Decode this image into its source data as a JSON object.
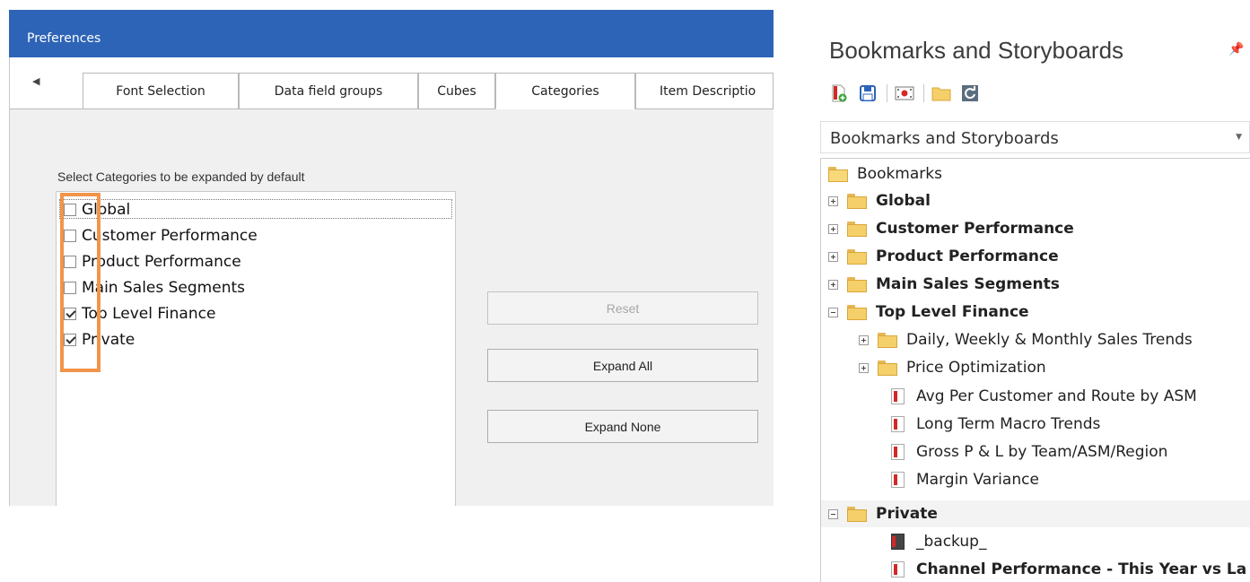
{
  "preferences": {
    "title": "Preferences",
    "tab_scroll_left": "◀",
    "tabs": [
      "Font Selection",
      "Data field groups",
      "Cubes",
      "Categories",
      "Item Descriptio"
    ],
    "active_tab": "Categories",
    "categories_label": "Select Categories to be expanded by default",
    "categories": [
      {
        "label": "Global",
        "checked": false
      },
      {
        "label": "Customer Performance",
        "checked": false
      },
      {
        "label": "Product Performance",
        "checked": false
      },
      {
        "label": "Main Sales Segments",
        "checked": false
      },
      {
        "label": "Top Level Finance",
        "checked": true
      },
      {
        "label": "Private",
        "checked": true
      }
    ],
    "buttons": {
      "reset": "Reset",
      "expand_all": "Expand All",
      "expand_none": "Expand None"
    },
    "colors": {
      "titlebar": "#2e64b7",
      "highlight": "#f0954a"
    }
  },
  "bookmarks_panel": {
    "title": "Bookmarks and Storyboards",
    "pin_icon": "pin-icon",
    "toolbar_icons": [
      "add-bookmark-icon",
      "save-icon",
      "record-icon",
      "open-folder-icon",
      "refresh-icon"
    ],
    "combo_value": "Bookmarks and Storyboards",
    "tree": {
      "root": "Bookmarks",
      "items": [
        {
          "label": "Global",
          "type": "folder",
          "expanded": false,
          "bold": true
        },
        {
          "label": "Customer Performance",
          "type": "folder",
          "expanded": false,
          "bold": true
        },
        {
          "label": "Product Performance",
          "type": "folder",
          "expanded": false,
          "bold": true
        },
        {
          "label": "Main Sales Segments",
          "type": "folder",
          "expanded": false,
          "bold": true
        },
        {
          "label": "Top Level Finance",
          "type": "folder",
          "expanded": true,
          "bold": true
        },
        {
          "label": "Daily, Weekly & Monthly Sales Trends",
          "type": "folder",
          "expanded": false,
          "bold": false
        },
        {
          "label": "Price Optimization",
          "type": "folder",
          "expanded": false,
          "bold": false
        },
        {
          "label": "Avg Per Customer and Route by ASM",
          "type": "doc",
          "bold": false
        },
        {
          "label": "Long Term Macro Trends",
          "type": "doc",
          "bold": false
        },
        {
          "label": "Gross P & L by Team/ASM/Region",
          "type": "doc",
          "bold": false
        },
        {
          "label": "Margin Variance",
          "type": "doc",
          "bold": false
        },
        {
          "label": "Private",
          "type": "folder",
          "expanded": true,
          "bold": true
        },
        {
          "label": "_backup_",
          "type": "doc-dark",
          "bold": false
        },
        {
          "label": "Channel Performance - This Year vs La",
          "type": "doc",
          "bold": true
        }
      ]
    }
  }
}
